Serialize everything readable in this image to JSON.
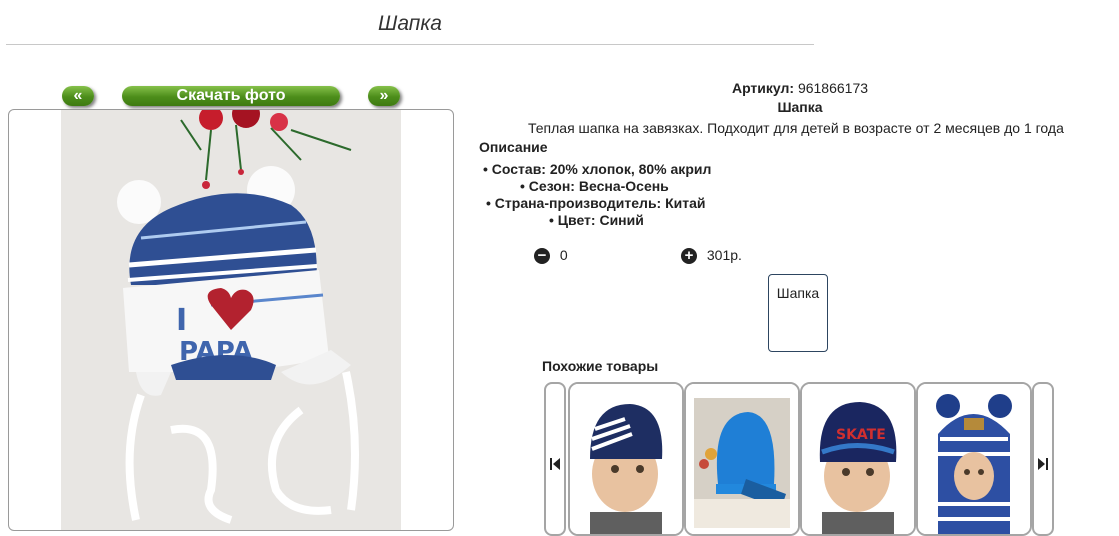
{
  "page": {
    "title": "Шапка"
  },
  "gallery": {
    "prev_label": "«",
    "download_label": "Скачать фото",
    "next_label": "»"
  },
  "product": {
    "article_label": "Артикул:",
    "article_value": "961866173",
    "name": "Шапка",
    "description": "Теплая шапка на завязках. Подходит для детей в возрасте от 2 месяцев до 1 года",
    "desc_heading": "Описание",
    "specs": [
      "Состав: 20% хлопок, 80% акрил",
      "Сезон: Весна-Осень",
      "Страна-производитель: Китай",
      "Цвет: Синий"
    ],
    "quantity": "0",
    "price": "301р.",
    "variant_label": "Шапка"
  },
  "similar": {
    "heading": "Похожие товары",
    "items": [
      {
        "icon": "hat-grey-white-stripes"
      },
      {
        "icon": "hat-blue-beanie"
      },
      {
        "icon": "hat-skate-red"
      },
      {
        "icon": "balaclava-striped-pompom"
      }
    ]
  }
}
